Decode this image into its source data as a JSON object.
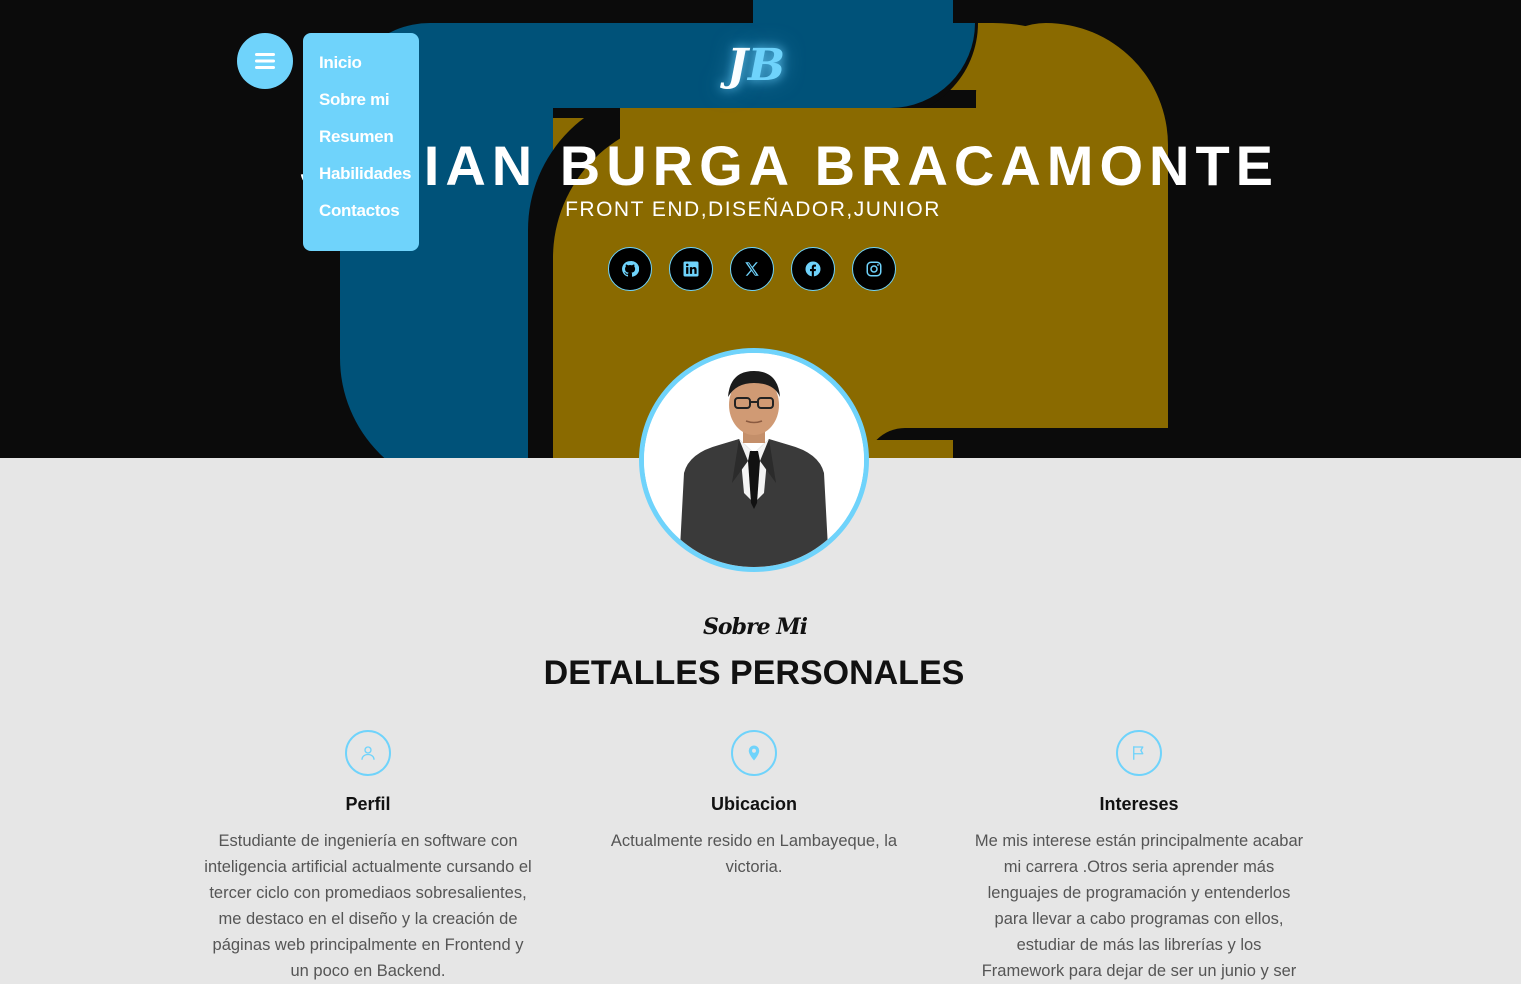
{
  "logo": {
    "first": "J",
    "second": "B"
  },
  "hero": {
    "name": "JULIAN BURGA BRACAMONTE",
    "role": "FRONT END,DISEÑADOR,JUNIOR"
  },
  "socials": [
    {
      "icon": "github-icon"
    },
    {
      "icon": "linkedin-icon"
    },
    {
      "icon": "x-twitter-icon"
    },
    {
      "icon": "facebook-icon"
    },
    {
      "icon": "instagram-icon"
    }
  ],
  "nav": {
    "items": [
      {
        "label": "Inicio"
      },
      {
        "label": "Sobre mi"
      },
      {
        "label": "Resumen"
      },
      {
        "label": "Habilidades"
      },
      {
        "label": "Contactos"
      }
    ]
  },
  "about": {
    "eyebrow": "Sobre Mi",
    "title": "DETALLES PERSONALES",
    "cards": [
      {
        "icon": "user-icon",
        "title": "Perfil",
        "text": "Estudiante de ingeniería en software con inteligencia artificial actualmente cursando el tercer ciclo con promediaos sobresalientes, me destaco en el diseño y la creación de páginas web principalmente en Frontend y un poco en Backend."
      },
      {
        "icon": "map-pin-icon",
        "title": "Ubicacion",
        "text": "Actualmente resido en Lambayeque, la victoria."
      },
      {
        "icon": "flag-icon",
        "title": "Intereses",
        "text": "Me mis interese están principalmente acabar mi carrera .Otros seria aprender más lenguajes de programación y entenderlos para llevar a cabo programas con ellos, estudiar de más las librerías y los Framework para dejar de ser un junio y ser"
      }
    ]
  },
  "colors": {
    "accent": "#6fd3fb",
    "blue": "#005279",
    "gold": "#8a6a00",
    "dark": "#0b0b0b",
    "light": "#e6e6e6"
  }
}
